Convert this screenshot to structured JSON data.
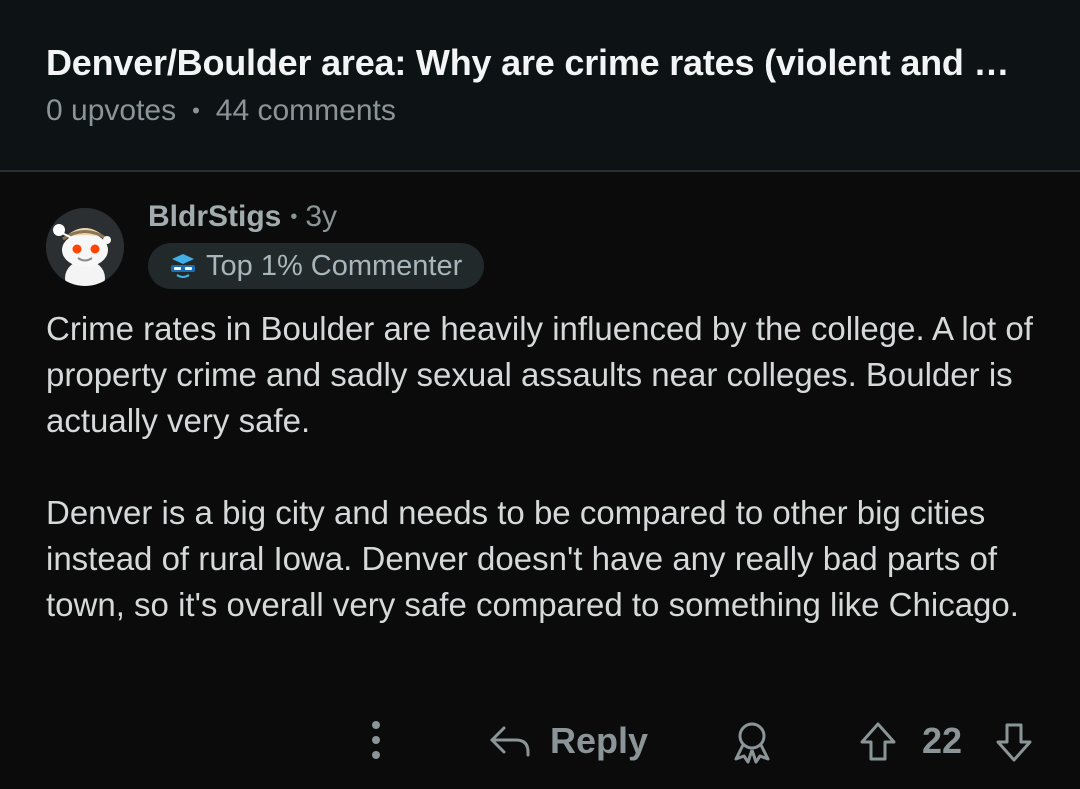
{
  "post": {
    "title": "Denver/Boulder area: Why are crime rates (violent and …",
    "upvotes": "0 upvotes",
    "separator": "•",
    "comments": "44 comments"
  },
  "comment": {
    "username": "BldrStigs",
    "separator": "•",
    "age": "3y",
    "flair": "Top 1% Commenter",
    "paragraphs": [
      "Crime rates in Boulder are heavily influenced by the college.  A lot of property crime and sadly sexual assaults near colleges.  Boulder is actually very safe.",
      "Denver is a big city and needs to be compared to other big cities instead of rural Iowa. Denver doesn't have any really bad parts of town, so it's overall very safe compared to something like Chicago."
    ],
    "actions": {
      "reply_label": "Reply",
      "score": "22"
    }
  },
  "icons": {
    "more": "more-options-icon",
    "reply": "reply-arrow-icon",
    "award": "award-icon",
    "upvote": "upvote-arrow-icon",
    "downvote": "downvote-arrow-icon",
    "flair": "top-commenter-badge-icon",
    "avatar": "snoo-avatar"
  },
  "colors": {
    "background": "#0b0b0b",
    "header_background": "#0d1314",
    "title": "#f2f4f5",
    "meta": "#8b9497",
    "body_text": "#d6d9da",
    "flair_background": "#22292b",
    "flair_icon": "#3fb0e8"
  }
}
